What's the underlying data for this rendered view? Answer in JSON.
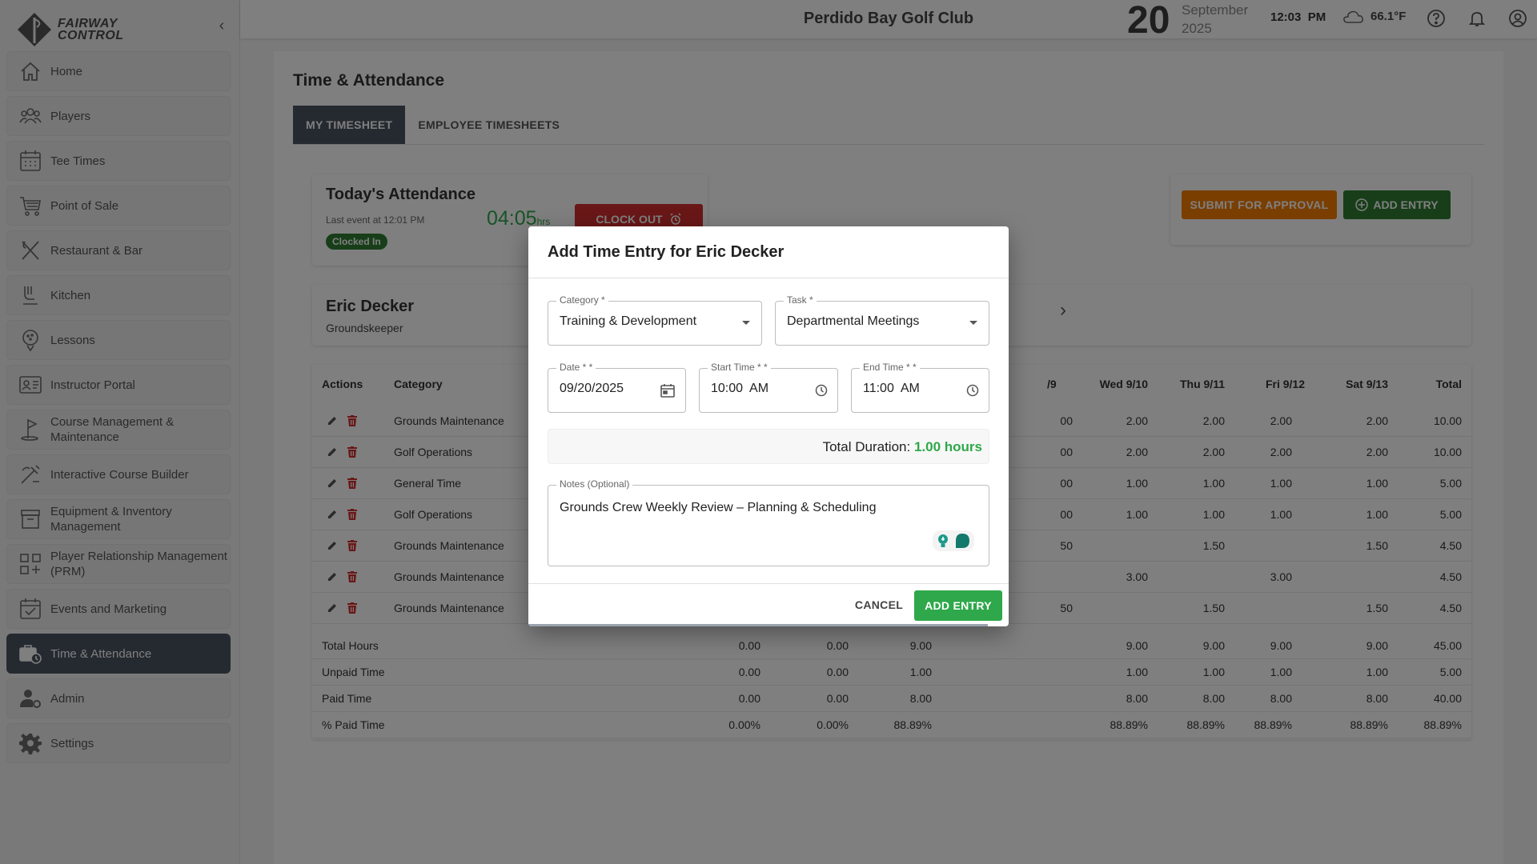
{
  "app": {
    "logo_text_line1": "FAIRWAY",
    "logo_text_line2": "CONTROL",
    "club_name": "Perdido Bay Golf Club",
    "date_day": "20",
    "date_month": "September",
    "date_year": "2025",
    "time": "12:03",
    "time_period": "PM",
    "temperature": "66.1°F"
  },
  "sidebar": {
    "items": [
      {
        "label": "Home",
        "icon": "home-icon"
      },
      {
        "label": "Players",
        "icon": "players-icon"
      },
      {
        "label": "Tee Times",
        "icon": "calendar-icon"
      },
      {
        "label": "Point of Sale",
        "icon": "cart-icon"
      },
      {
        "label": "Restaurant & Bar",
        "icon": "utensils-icon"
      },
      {
        "label": "Kitchen",
        "icon": "kitchen-icon"
      },
      {
        "label": "Lessons",
        "icon": "golf-ball-icon"
      },
      {
        "label": "Instructor Portal",
        "icon": "instructor-icon"
      },
      {
        "label": "Course Management & Maintenance",
        "icon": "flag-icon"
      },
      {
        "label": "Interactive Course Builder",
        "icon": "builder-icon"
      },
      {
        "label": "Equipment & Inventory Management",
        "icon": "inventory-icon"
      },
      {
        "label": "Player Relationship Management (PRM)",
        "icon": "grid-icon"
      },
      {
        "label": "Events and Marketing",
        "icon": "calendar-check-icon"
      },
      {
        "label": "Time & Attendance",
        "icon": "timeclock-icon"
      },
      {
        "label": "Admin",
        "icon": "admin-icon"
      },
      {
        "label": "Settings",
        "icon": "gear-icon"
      }
    ],
    "active_index": 13
  },
  "page": {
    "title": "Time & Attendance",
    "tabs": [
      "MY TIMESHEET",
      "EMPLOYEE TIMESHEETS"
    ],
    "active_tab": 0
  },
  "attendance": {
    "title": "Today's Attendance",
    "last_event": "Last event at 12:01 PM",
    "status": "Clocked In",
    "timer": "04:05",
    "timer_unit": "hrs",
    "clock_out_label": "CLOCK OUT"
  },
  "actions": {
    "submit_label": "SUBMIT FOR APPROVAL",
    "add_entry_label": "ADD ENTRY"
  },
  "employee": {
    "name": "Eric Decker",
    "role": "Groundskeeper"
  },
  "timesheet": {
    "headers": [
      "Actions",
      "Category",
      "/9",
      "Wed 9/10",
      "Thu 9/11",
      "Fri 9/12",
      "Sat 9/13",
      "Total"
    ],
    "rows": [
      {
        "category": "Grounds Maintenance",
        "c9": "00",
        "wed": "2.00",
        "thu": "2.00",
        "fri": "2.00",
        "sat": "2.00",
        "total": "10.00"
      },
      {
        "category": "Golf Operations",
        "c9": "00",
        "wed": "2.00",
        "thu": "2.00",
        "fri": "2.00",
        "sat": "2.00",
        "total": "10.00"
      },
      {
        "category": "General Time",
        "c9": "00",
        "wed": "1.00",
        "thu": "1.00",
        "fri": "1.00",
        "sat": "1.00",
        "total": "5.00"
      },
      {
        "category": "Golf Operations",
        "c9": "00",
        "wed": "1.00",
        "thu": "1.00",
        "fri": "1.00",
        "sat": "1.00",
        "total": "5.00"
      },
      {
        "category": "Grounds Maintenance",
        "c9": "50",
        "wed": "",
        "thu": "1.50",
        "fri": "",
        "sat": "1.50",
        "total": "4.50"
      },
      {
        "category": "Grounds Maintenance",
        "c9": "",
        "wed": "3.00",
        "thu": "",
        "fri": "3.00",
        "sat": "",
        "total": "4.50"
      },
      {
        "category": "Grounds Maintenance",
        "c9": "50",
        "wed": "",
        "thu": "1.50",
        "fri": "",
        "sat": "1.50",
        "total": "4.50"
      }
    ],
    "summary": [
      {
        "label": "Total Hours",
        "a": "0.00",
        "b": "0.00",
        "c": "9.00",
        "wed": "9.00",
        "thu": "9.00",
        "fri": "9.00",
        "sat": "9.00",
        "total": "45.00"
      },
      {
        "label": "Unpaid Time",
        "a": "0.00",
        "b": "0.00",
        "c": "1.00",
        "wed": "1.00",
        "thu": "1.00",
        "fri": "1.00",
        "sat": "1.00",
        "total": "5.00"
      },
      {
        "label": "Paid Time",
        "a": "0.00",
        "b": "0.00",
        "c": "8.00",
        "wed": "8.00",
        "thu": "8.00",
        "fri": "8.00",
        "sat": "8.00",
        "total": "40.00"
      },
      {
        "label": "% Paid Time",
        "a": "0.00%",
        "b": "0.00%",
        "c": "88.89%",
        "wed": "88.89%",
        "thu": "88.89%",
        "fri": "88.89%",
        "sat": "88.89%",
        "total": "88.89%"
      }
    ]
  },
  "dialog": {
    "title": "Add Time Entry for Eric Decker",
    "category_label": "Category *",
    "category_value": "Training & Development",
    "task_label": "Task *",
    "task_value": "Departmental Meetings",
    "date_label": "Date * *",
    "date_value": "09/20/2025",
    "start_label": "Start Time * *",
    "start_value": "10:00  AM",
    "end_label": "End Time * *",
    "end_value": "11:00  AM",
    "duration_label": "Total Duration:",
    "duration_value": "1.00 hours",
    "notes_label": "Notes (Optional)",
    "notes_value": "Grounds Crew Weekly Review – Planning & Scheduling",
    "cancel_label": "CANCEL",
    "add_label": "ADD ENTRY"
  }
}
